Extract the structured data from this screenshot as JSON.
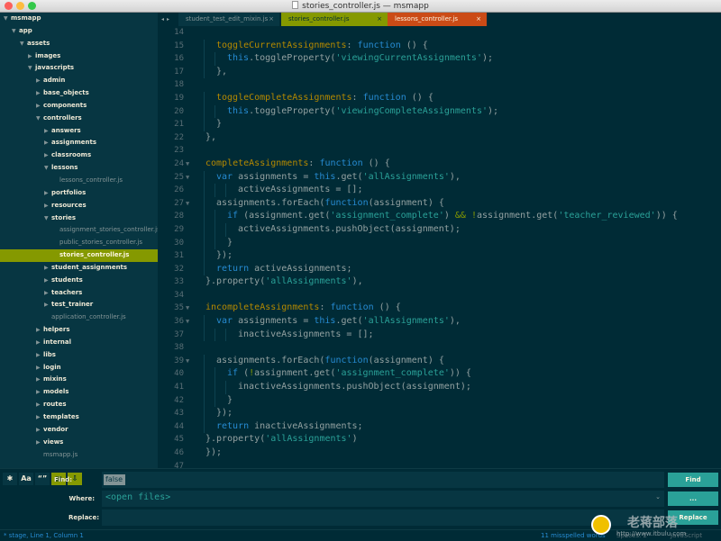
{
  "window": {
    "title": "stories_controller.js — msmapp",
    "lights": [
      "#fc605c",
      "#fdbc40",
      "#34c84a"
    ]
  },
  "tabs": {
    "nav_left": "◂",
    "nav_right": "▸",
    "items": [
      {
        "label": "student_test_edit_mixin.js",
        "close": "×"
      },
      {
        "label": "stories_controller.js",
        "close": "×"
      },
      {
        "label": "lessons_controller.js",
        "close": "×"
      }
    ]
  },
  "sidebar": {
    "items": [
      {
        "label": "msmapp",
        "type": "folder",
        "open": true,
        "depth": 0
      },
      {
        "label": "app",
        "type": "folder",
        "open": true,
        "depth": 1
      },
      {
        "label": "assets",
        "type": "folder",
        "open": true,
        "depth": 2
      },
      {
        "label": "images",
        "type": "folder",
        "open": false,
        "depth": 3
      },
      {
        "label": "javascripts",
        "type": "folder",
        "open": true,
        "depth": 3
      },
      {
        "label": "admin",
        "type": "folder",
        "open": false,
        "depth": 4
      },
      {
        "label": "base_objects",
        "type": "folder",
        "open": false,
        "depth": 4
      },
      {
        "label": "components",
        "type": "folder",
        "open": false,
        "depth": 4
      },
      {
        "label": "controllers",
        "type": "folder",
        "open": true,
        "depth": 4
      },
      {
        "label": "answers",
        "type": "folder",
        "open": false,
        "depth": 5
      },
      {
        "label": "assignments",
        "type": "folder",
        "open": false,
        "depth": 5
      },
      {
        "label": "classrooms",
        "type": "folder",
        "open": false,
        "depth": 5
      },
      {
        "label": "lessons",
        "type": "folder",
        "open": true,
        "depth": 5
      },
      {
        "label": "lessons_controller.js",
        "type": "file",
        "depth": 6
      },
      {
        "label": "portfolios",
        "type": "folder",
        "open": false,
        "depth": 5
      },
      {
        "label": "resources",
        "type": "folder",
        "open": false,
        "depth": 5
      },
      {
        "label": "stories",
        "type": "folder",
        "open": true,
        "depth": 5
      },
      {
        "label": "assignment_stories_controller.js",
        "type": "file",
        "depth": 6
      },
      {
        "label": "public_stories_controller.js",
        "type": "file",
        "depth": 6
      },
      {
        "label": "stories_controller.js",
        "type": "file",
        "depth": 6,
        "selected": true
      },
      {
        "label": "student_assignments",
        "type": "folder",
        "open": false,
        "depth": 5
      },
      {
        "label": "students",
        "type": "folder",
        "open": false,
        "depth": 5
      },
      {
        "label": "teachers",
        "type": "folder",
        "open": false,
        "depth": 5
      },
      {
        "label": "test_trainer",
        "type": "folder",
        "open": false,
        "depth": 5
      },
      {
        "label": "application_controller.js",
        "type": "file",
        "depth": 5
      },
      {
        "label": "helpers",
        "type": "folder",
        "open": false,
        "depth": 4
      },
      {
        "label": "internal",
        "type": "folder",
        "open": false,
        "depth": 4
      },
      {
        "label": "libs",
        "type": "folder",
        "open": false,
        "depth": 4
      },
      {
        "label": "login",
        "type": "folder",
        "open": false,
        "depth": 4
      },
      {
        "label": "mixins",
        "type": "folder",
        "open": false,
        "depth": 4
      },
      {
        "label": "models",
        "type": "folder",
        "open": false,
        "depth": 4
      },
      {
        "label": "routes",
        "type": "folder",
        "open": false,
        "depth": 4
      },
      {
        "label": "templates",
        "type": "folder",
        "open": false,
        "depth": 4
      },
      {
        "label": "vendor",
        "type": "folder",
        "open": false,
        "depth": 4
      },
      {
        "label": "views",
        "type": "folder",
        "open": false,
        "depth": 4
      },
      {
        "label": "msmapp.js",
        "type": "file",
        "depth": 4
      }
    ]
  },
  "editor": {
    "lines": [
      {
        "n": "14",
        "fold": false,
        "indent": 0,
        "tokens": []
      },
      {
        "n": "15",
        "fold": false,
        "indent": 1,
        "tokens": [
          [
            "prop",
            "toggleCurrentAssignments"
          ],
          [
            "punc",
            ": "
          ],
          [
            "kw",
            "function"
          ],
          [
            "punc",
            " () {"
          ]
        ]
      },
      {
        "n": "16",
        "fold": false,
        "indent": 2,
        "tokens": [
          [
            "this",
            "this"
          ],
          [
            "punc",
            ".toggleProperty("
          ],
          [
            "str",
            "'viewingCurrentAssignments'"
          ],
          [
            "punc",
            ");"
          ]
        ]
      },
      {
        "n": "17",
        "fold": false,
        "indent": 1,
        "tokens": [
          [
            "punc",
            "},"
          ]
        ]
      },
      {
        "n": "18",
        "fold": false,
        "indent": 0,
        "tokens": []
      },
      {
        "n": "19",
        "fold": false,
        "indent": 1,
        "tokens": [
          [
            "prop",
            "toggleCompleteAssignments"
          ],
          [
            "punc",
            ": "
          ],
          [
            "kw",
            "function"
          ],
          [
            "punc",
            " () {"
          ]
        ]
      },
      {
        "n": "20",
        "fold": false,
        "indent": 2,
        "tokens": [
          [
            "this",
            "this"
          ],
          [
            "punc",
            ".toggleProperty("
          ],
          [
            "str",
            "'viewingCompleteAssignments'"
          ],
          [
            "punc",
            ");"
          ]
        ]
      },
      {
        "n": "21",
        "fold": false,
        "indent": 1,
        "tokens": [
          [
            "punc",
            "}"
          ]
        ]
      },
      {
        "n": "22",
        "fold": false,
        "indent": 0,
        "tokens": [
          [
            "punc",
            "},"
          ]
        ]
      },
      {
        "n": "23",
        "fold": false,
        "indent": 0,
        "tokens": []
      },
      {
        "n": "24",
        "fold": true,
        "indent": 0,
        "tokens": [
          [
            "prop",
            "completeAssignments"
          ],
          [
            "punc",
            ": "
          ],
          [
            "kw",
            "function"
          ],
          [
            "punc",
            " () {"
          ]
        ]
      },
      {
        "n": "25",
        "fold": true,
        "indent": 1,
        "tokens": [
          [
            "kw",
            "var"
          ],
          [
            "punc",
            " assignments = "
          ],
          [
            "this",
            "this"
          ],
          [
            "punc",
            ".get("
          ],
          [
            "str",
            "'allAssignments'"
          ],
          [
            "punc",
            "),"
          ]
        ]
      },
      {
        "n": "26",
        "fold": false,
        "indent": 3,
        "tokens": [
          [
            "punc",
            "activeAssignments = [];"
          ]
        ]
      },
      {
        "n": "27",
        "fold": true,
        "indent": 1,
        "tokens": [
          [
            "punc",
            "assignments.forEach("
          ],
          [
            "kw",
            "function"
          ],
          [
            "punc",
            "(assignment) {"
          ]
        ]
      },
      {
        "n": "28",
        "fold": false,
        "indent": 2,
        "tokens": [
          [
            "kw",
            "if"
          ],
          [
            "punc",
            " (assignment.get("
          ],
          [
            "str",
            "'assignment_complete'"
          ],
          [
            "punc",
            ") "
          ],
          [
            "op",
            "&&"
          ],
          [
            "punc",
            " "
          ],
          [
            "op",
            "!"
          ],
          [
            "punc",
            "assignment.get("
          ],
          [
            "str",
            "'teacher_reviewed'"
          ],
          [
            "punc",
            ")) {"
          ]
        ]
      },
      {
        "n": "29",
        "fold": false,
        "indent": 3,
        "tokens": [
          [
            "punc",
            "activeAssignments.pushObject(assignment);"
          ]
        ]
      },
      {
        "n": "30",
        "fold": false,
        "indent": 2,
        "tokens": [
          [
            "punc",
            "}"
          ]
        ]
      },
      {
        "n": "31",
        "fold": false,
        "indent": 1,
        "tokens": [
          [
            "punc",
            "});"
          ]
        ]
      },
      {
        "n": "32",
        "fold": false,
        "indent": 1,
        "tokens": [
          [
            "kw",
            "return"
          ],
          [
            "punc",
            " activeAssignments;"
          ]
        ]
      },
      {
        "n": "33",
        "fold": false,
        "indent": 0,
        "tokens": [
          [
            "punc",
            "}.property("
          ],
          [
            "str",
            "'allAssignments'"
          ],
          [
            "punc",
            "),"
          ]
        ]
      },
      {
        "n": "34",
        "fold": false,
        "indent": 0,
        "tokens": []
      },
      {
        "n": "35",
        "fold": true,
        "indent": 0,
        "tokens": [
          [
            "prop",
            "incompleteAssignments"
          ],
          [
            "punc",
            ": "
          ],
          [
            "kw",
            "function"
          ],
          [
            "punc",
            " () {"
          ]
        ]
      },
      {
        "n": "36",
        "fold": true,
        "indent": 1,
        "tokens": [
          [
            "kw",
            "var"
          ],
          [
            "punc",
            " assignments = "
          ],
          [
            "this",
            "this"
          ],
          [
            "punc",
            ".get("
          ],
          [
            "str",
            "'allAssignments'"
          ],
          [
            "punc",
            "),"
          ]
        ]
      },
      {
        "n": "37",
        "fold": false,
        "indent": 3,
        "tokens": [
          [
            "punc",
            "inactiveAssignments = [];"
          ]
        ]
      },
      {
        "n": "38",
        "fold": false,
        "indent": 0,
        "tokens": []
      },
      {
        "n": "39",
        "fold": true,
        "indent": 1,
        "tokens": [
          [
            "punc",
            "assignments.forEach("
          ],
          [
            "kw",
            "function"
          ],
          [
            "punc",
            "(assignment) {"
          ]
        ]
      },
      {
        "n": "40",
        "fold": false,
        "indent": 2,
        "tokens": [
          [
            "kw",
            "if"
          ],
          [
            "punc",
            " ("
          ],
          [
            "op",
            "!"
          ],
          [
            "punc",
            "assignment.get("
          ],
          [
            "str",
            "'assignment_complete'"
          ],
          [
            "punc",
            ")) {"
          ]
        ]
      },
      {
        "n": "41",
        "fold": false,
        "indent": 3,
        "tokens": [
          [
            "punc",
            "inactiveAssignments.pushObject(assignment);"
          ]
        ]
      },
      {
        "n": "42",
        "fold": false,
        "indent": 2,
        "tokens": [
          [
            "punc",
            "}"
          ]
        ]
      },
      {
        "n": "43",
        "fold": false,
        "indent": 1,
        "tokens": [
          [
            "punc",
            "});"
          ]
        ]
      },
      {
        "n": "44",
        "fold": false,
        "indent": 1,
        "tokens": [
          [
            "kw",
            "return"
          ],
          [
            "punc",
            " inactiveAssignments;"
          ]
        ]
      },
      {
        "n": "45",
        "fold": false,
        "indent": 0,
        "tokens": [
          [
            "punc",
            "}.property("
          ],
          [
            "str",
            "'allAssignments'"
          ],
          [
            "punc",
            ")"
          ]
        ]
      },
      {
        "n": "46",
        "fold": false,
        "indent": 0,
        "tokens": [
          [
            "punc",
            "});"
          ]
        ]
      },
      {
        "n": "47",
        "fold": false,
        "indent": 0,
        "tokens": []
      }
    ]
  },
  "find": {
    "toggles": [
      "✱",
      "Aa",
      "“”",
      "▤",
      "⇩"
    ],
    "find_label": "Find:",
    "find_value": "false",
    "where_label": "Where:",
    "where_value": "<open files>",
    "replace_label": "Replace:",
    "replace_value": "",
    "find_button": "Find",
    "where_button": "...",
    "replace_button": "Replace",
    "chevron": "⌄"
  },
  "status": {
    "left": "* stage, Line 1, Column 1",
    "right": "11 misspelled words",
    "spaces": "Spaces: 2",
    "syntax": "JavaScript"
  },
  "watermark": {
    "text": "老蒋部落",
    "url": "http://www.itbulu.com"
  },
  "colors": {
    "base03": "#002b36",
    "base02": "#073642",
    "green": "#859900",
    "orange": "#cb4b16",
    "cyan": "#2aa198",
    "blue": "#268bd2",
    "yellow": "#b58900"
  }
}
